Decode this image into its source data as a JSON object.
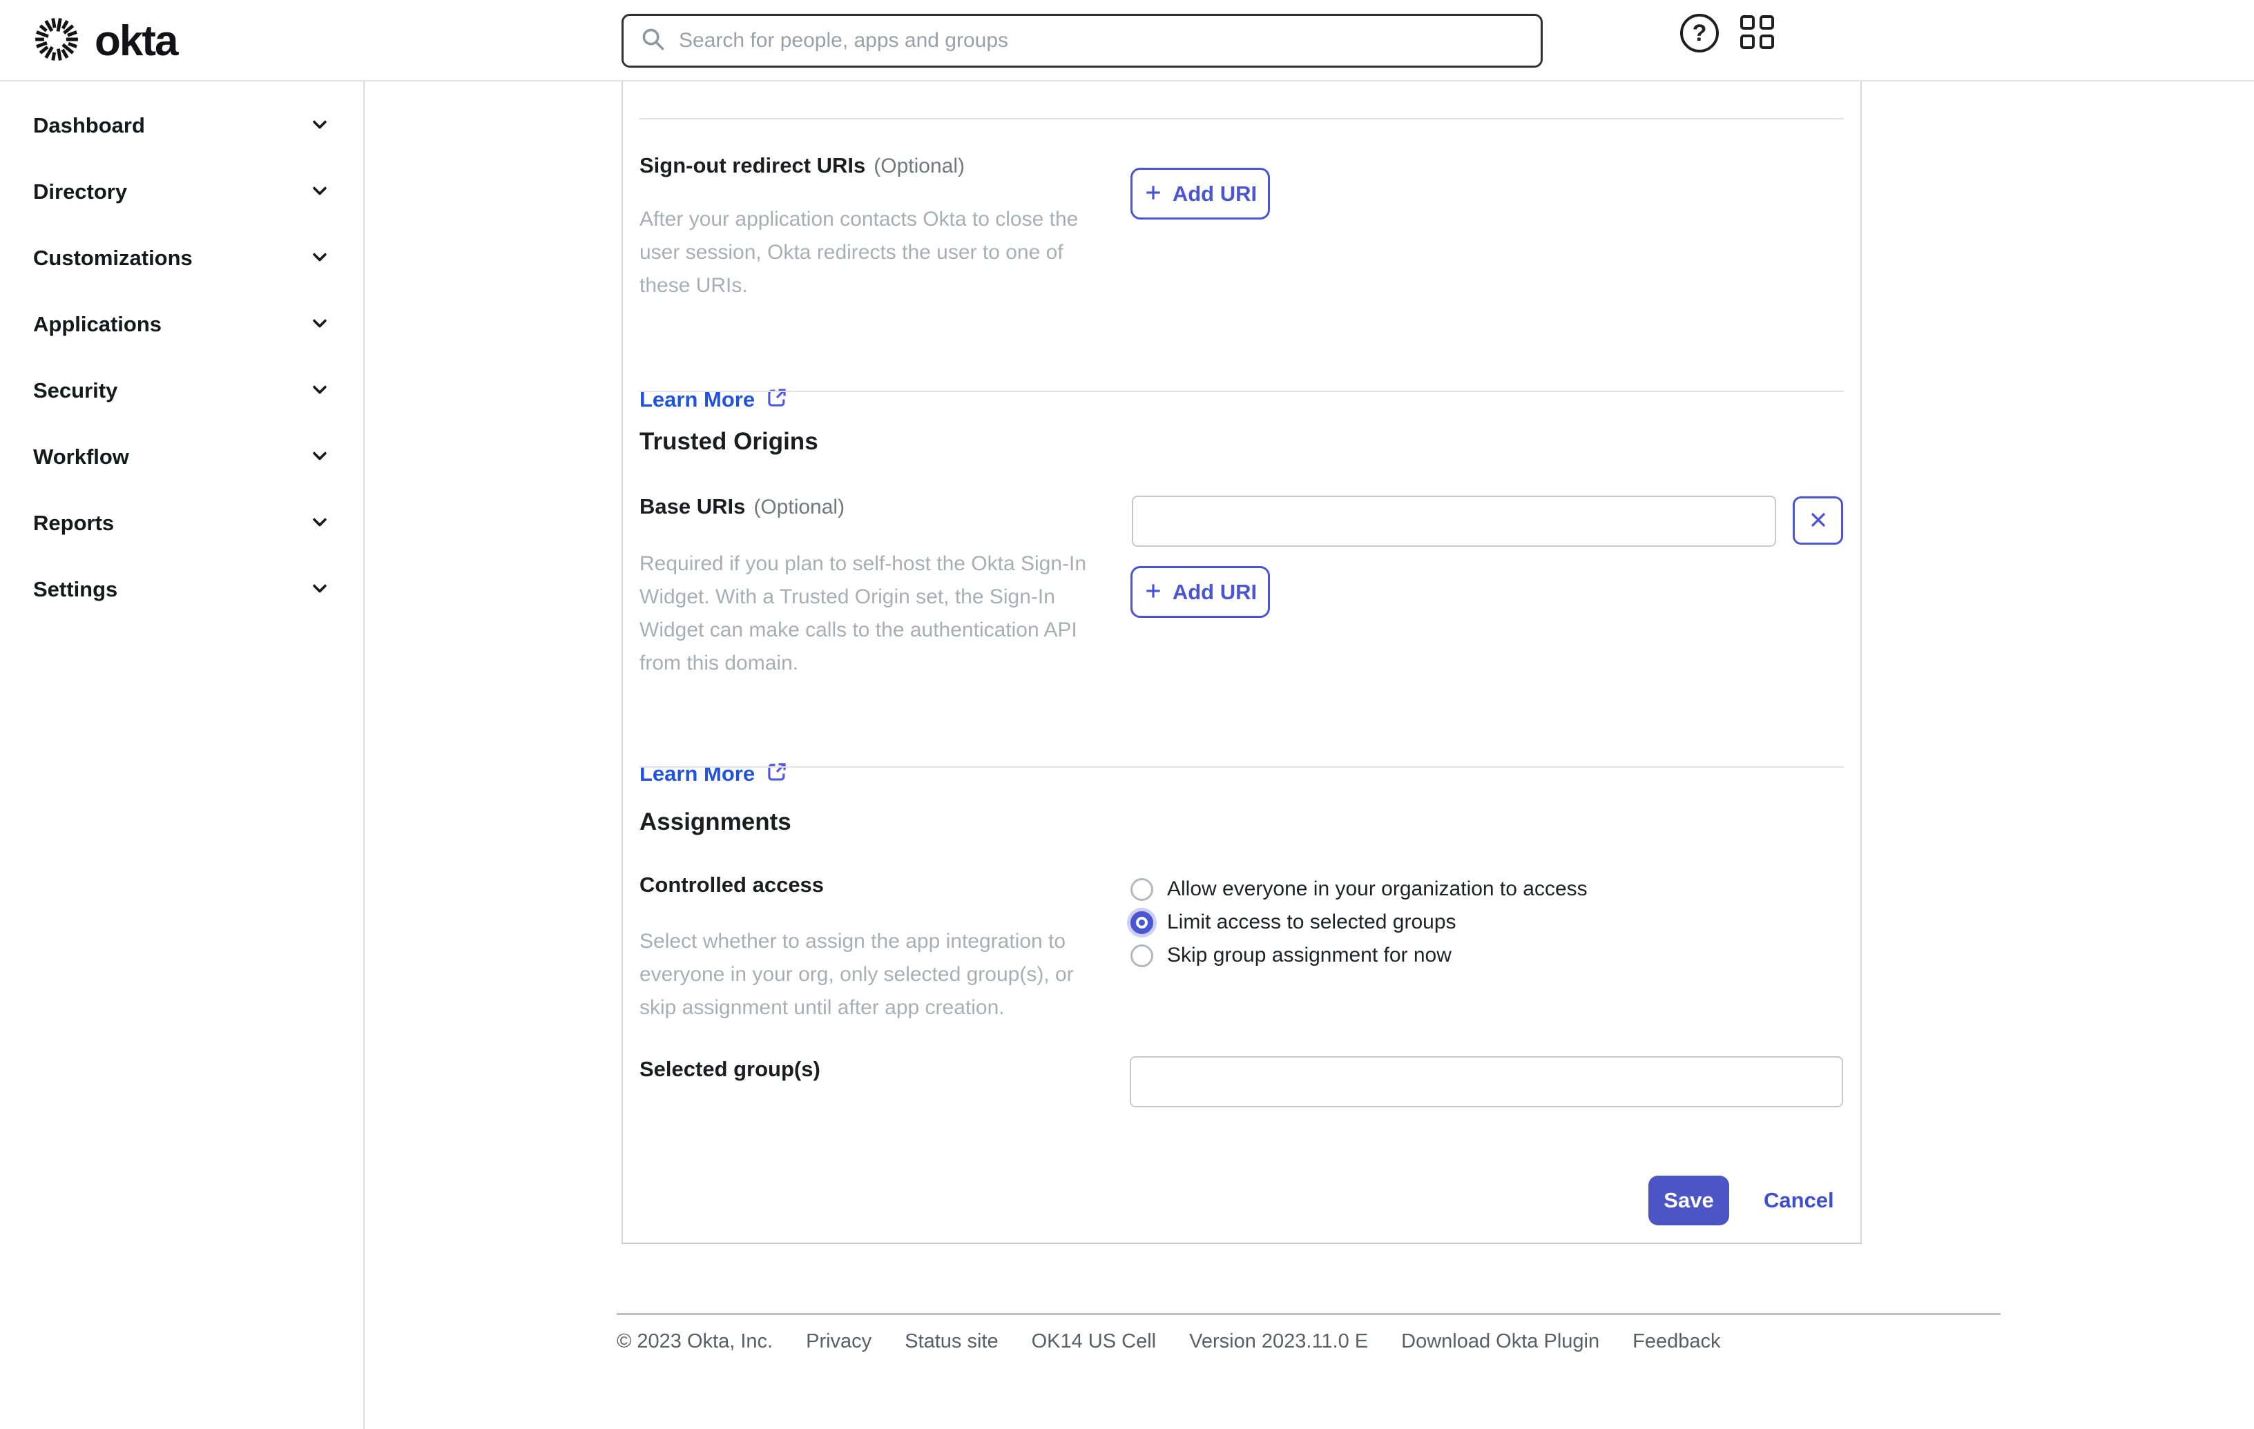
{
  "header": {
    "brand": "okta",
    "search": {
      "placeholder": "Search for people, apps and groups",
      "value": ""
    },
    "icons": {
      "help_glyph": "?"
    }
  },
  "sidebar": {
    "items": [
      "Dashboard",
      "Directory",
      "Customizations",
      "Applications",
      "Security",
      "Workflow",
      "Reports",
      "Settings"
    ]
  },
  "main": {
    "signout": {
      "label": "Sign-out redirect URIs",
      "optional": "(Optional)",
      "description": "After your application contacts Okta to close the user session, Okta redirects the user to one of these URIs.",
      "learn_more": "Learn More",
      "add_uri": "Add URI"
    },
    "trusted": {
      "heading": "Trusted Origins",
      "label": "Base URIs",
      "optional": "(Optional)",
      "input_value": "",
      "description": "Required if you plan to self-host the Okta Sign-In Widget. With a Trusted Origin set, the Sign-In Widget can make calls to the authentication API from this domain.",
      "learn_more": "Learn More",
      "add_uri": "Add URI"
    },
    "assignments": {
      "heading": "Assignments",
      "label": "Controlled access",
      "description": "Select whether to assign the app integration to everyone in your org, only selected group(s), or skip assignment until after app creation.",
      "radios": [
        {
          "label": "Allow everyone in your organization to access",
          "selected": false
        },
        {
          "label": "Limit access to selected groups",
          "selected": true
        },
        {
          "label": "Skip group assignment for now",
          "selected": false
        }
      ],
      "selected_groups_label": "Selected group(s)",
      "selected_groups_value": ""
    },
    "actions": {
      "save": "Save",
      "cancel": "Cancel"
    }
  },
  "footer": {
    "items": [
      "© 2023 Okta, Inc.",
      "Privacy",
      "Status site",
      "OK14 US Cell",
      "Version 2023.11.0 E",
      "Download Okta Plugin",
      "Feedback"
    ]
  },
  "colors": {
    "link_blue": "#2153e2",
    "button_indigo": "#4a55d6",
    "save_background": "#4c55c5",
    "text_primary": "#1c1d21",
    "text_muted": "#aaadb4"
  }
}
